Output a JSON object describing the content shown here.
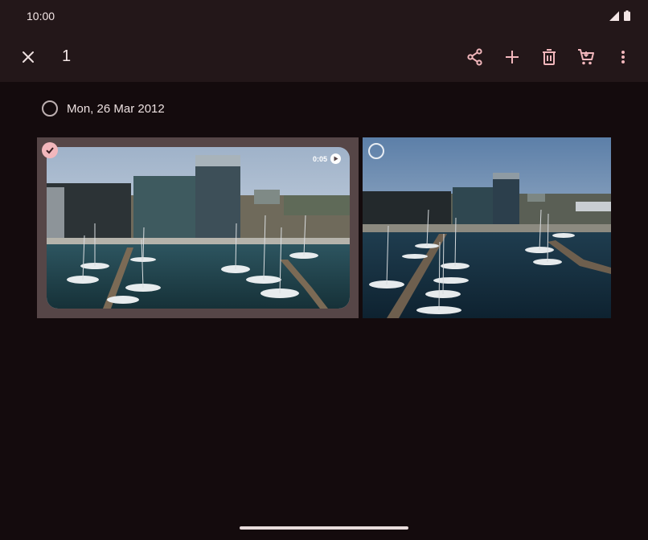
{
  "status_bar": {
    "time": "10:00"
  },
  "toolbar": {
    "selected_count": "1",
    "icons": [
      "close-icon",
      "share-icon",
      "add-icon",
      "delete-icon",
      "shopping-cart-icon",
      "more-vert-icon"
    ]
  },
  "group": {
    "date_label": "Mon, 26 Mar 2012",
    "items": [
      {
        "type": "video",
        "duration": "0:05",
        "selected": true
      },
      {
        "type": "photo",
        "selected": false
      }
    ]
  },
  "colors": {
    "accent": "#f2b7bc",
    "background": "#140b0d",
    "toolbar": "#231719",
    "selected_tile": "#564647"
  }
}
